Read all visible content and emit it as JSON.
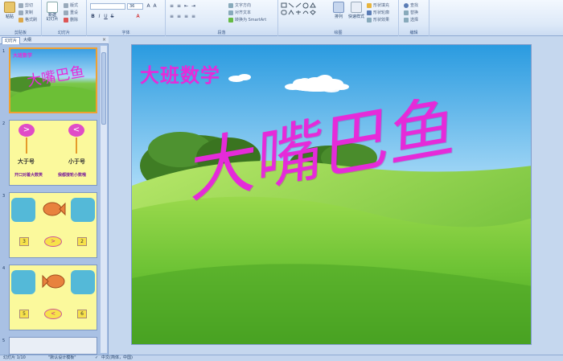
{
  "ribbon": {
    "clipboard": {
      "label": "剪贴板",
      "paste": "粘贴",
      "cut": "剪切",
      "copy": "复制",
      "format_painter": "格式刷"
    },
    "slides": {
      "label": "幻灯片",
      "new_slide": "新建\n幻灯片",
      "layout": "版式",
      "reset": "重设",
      "delete": "删除"
    },
    "font": {
      "label": "字体",
      "font_name": "",
      "font_size": "36"
    },
    "paragraph": {
      "label": "段落",
      "text_direction": "文字方向",
      "align_text": "对齐文本",
      "smartart": "转换为 SmartArt"
    },
    "drawing": {
      "label": "绘图",
      "arrange": "排列",
      "quick_styles": "快速样式",
      "fill": "形状填充",
      "outline": "形状轮廓",
      "effects": "形状效果"
    },
    "editing": {
      "label": "编辑",
      "find": "查找",
      "replace": "替换",
      "select": "选择"
    }
  },
  "pane": {
    "tab_slides": "幻灯片",
    "tab_outline": "大纲",
    "close": "×",
    "thumbs": [
      {
        "num": "1",
        "title": "大班数学",
        "big": "大嘴巴鱼"
      },
      {
        "num": "2",
        "left_label": "大于号",
        "right_label": "小于号",
        "left_caption": "开口对着大数笑",
        "right_caption": "我都接轮小数哦",
        "left_sym": ">",
        "right_sym": "<"
      },
      {
        "num": "3",
        "left": "3",
        "sym": ">",
        "right": "2"
      },
      {
        "num": "4",
        "left": "5",
        "sym": "<",
        "right": "6"
      },
      {
        "num": "5"
      }
    ]
  },
  "slide": {
    "title": "大班数学",
    "big_title": "大嘴巴鱼"
  },
  "status": {
    "slide_no": "幻灯片 1/10",
    "theme": "\"默认设计模板\"",
    "lang": "中文(简体，中国)"
  },
  "colors": {
    "title": "#e52bd9",
    "sky": "#2a9be0",
    "grass": "#6cc234"
  }
}
